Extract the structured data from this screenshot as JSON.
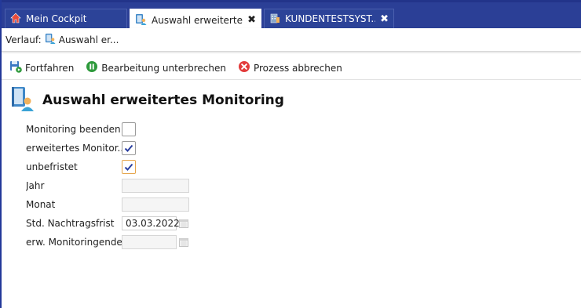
{
  "tabs": [
    {
      "label": "Mein Cockpit",
      "icon": "home-icon",
      "active": false,
      "closable": false
    },
    {
      "label": "Auswahl erweiterte...",
      "icon": "monitoring-doc-icon",
      "active": true,
      "closable": true
    },
    {
      "label": "KUNDENTESTSYST...",
      "icon": "building-icon",
      "active": false,
      "closable": true
    }
  ],
  "tab_close_glyph": "✖",
  "breadcrumb": {
    "prefix": "Verlauf:",
    "item_label": "Auswahl er..."
  },
  "toolbar": {
    "continue_label": "Fortfahren",
    "pause_label": "Bearbeitung unterbrechen",
    "cancel_label": "Prozess abbrechen"
  },
  "page": {
    "title": "Auswahl erweitertes Monitoring"
  },
  "form": {
    "monitoring_beenden": {
      "label": "Monitoring beenden",
      "checked": false
    },
    "erweitertes_monitoring": {
      "label": "erweitertes Monitor...",
      "checked": true
    },
    "unbefristet": {
      "label": "unbefristet",
      "checked": true
    },
    "jahr": {
      "label": "Jahr",
      "value": ""
    },
    "monat": {
      "label": "Monat",
      "value": ""
    },
    "std_nachtragsfrist": {
      "label": "Std. Nachtragsfrist",
      "value": "03.03.2022"
    },
    "erw_monitoringende": {
      "label": "erw. Monitoringende",
      "value": ""
    }
  },
  "colors": {
    "tabbar": "#2b3f96",
    "checkmark": "#2a3fa0",
    "focus_border": "#e5a54b",
    "pause_green": "#2e9a3c",
    "cancel_red": "#e23b3b"
  }
}
